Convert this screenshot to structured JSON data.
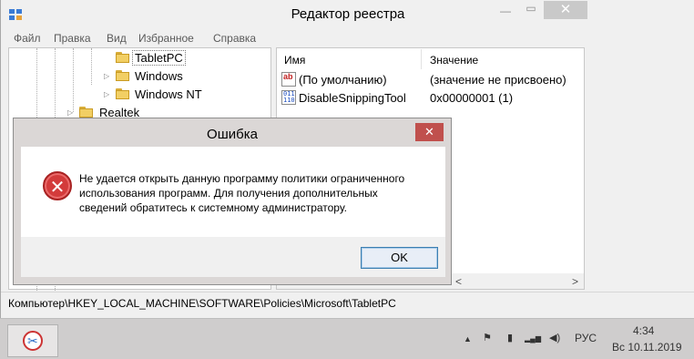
{
  "window": {
    "title": "Редактор реестра",
    "minimize_glyph": "—",
    "maximize_glyph": "▭",
    "close_glyph": "✕"
  },
  "menu": [
    "Файл",
    "Правка",
    "Вид",
    "Избранное",
    "Справка"
  ],
  "tree": {
    "nodes": [
      {
        "label": "TabletPC",
        "selected": true
      },
      {
        "label": "Windows",
        "expander": "▷"
      },
      {
        "label": "Windows NT",
        "expander": "▷"
      },
      {
        "label": "Realtek",
        "expander": "▷"
      }
    ]
  },
  "list": {
    "columns": {
      "name": "Имя",
      "value": "Значение"
    },
    "rows": [
      {
        "icon": "string-value-icon",
        "icon_text": "ab",
        "name": "(По умолчанию)",
        "value": "(значение не присвоено)"
      },
      {
        "icon": "binary-value-icon",
        "icon_text": "011 110",
        "name": "DisableSnippingTool",
        "value": "0x00000001 (1)"
      }
    ]
  },
  "scrollbar": {
    "left_arrow": "<",
    "right_arrow": ">"
  },
  "status": {
    "path": "Компьютер\\HKEY_LOCAL_MACHINE\\SOFTWARE\\Policies\\Microsoft\\TabletPC"
  },
  "dialog": {
    "title": "Ошибка",
    "close_glyph": "✕",
    "icon": "error-icon",
    "icon_glyph": "✕",
    "message_lines": [
      "Не удается открыть данную программу политики ограниченного",
      "использования программ. Для получения дополнительных",
      "сведений обратитесь к системному администратору."
    ],
    "ok_label": "OK"
  },
  "taskbar": {
    "app_icon": "snipping-tool-icon",
    "app_glyph": "✂",
    "tray_icons": [
      {
        "name": "show-hidden-icons-icon",
        "glyph": "▲"
      },
      {
        "name": "action-center-flag-icon",
        "glyph": "⚑"
      },
      {
        "name": "battery-icon",
        "glyph": "▮"
      },
      {
        "name": "network-signal-icon",
        "glyph": "▂▄▆"
      },
      {
        "name": "volume-icon",
        "glyph": "◀)"
      }
    ],
    "language": "РУС",
    "time": "4:34",
    "date": "Вс 10.11.2019"
  },
  "colors": {
    "dialog_close": "#c0504d",
    "error_icon": "#d33b3b",
    "ok_border": "#3c7fb1"
  }
}
